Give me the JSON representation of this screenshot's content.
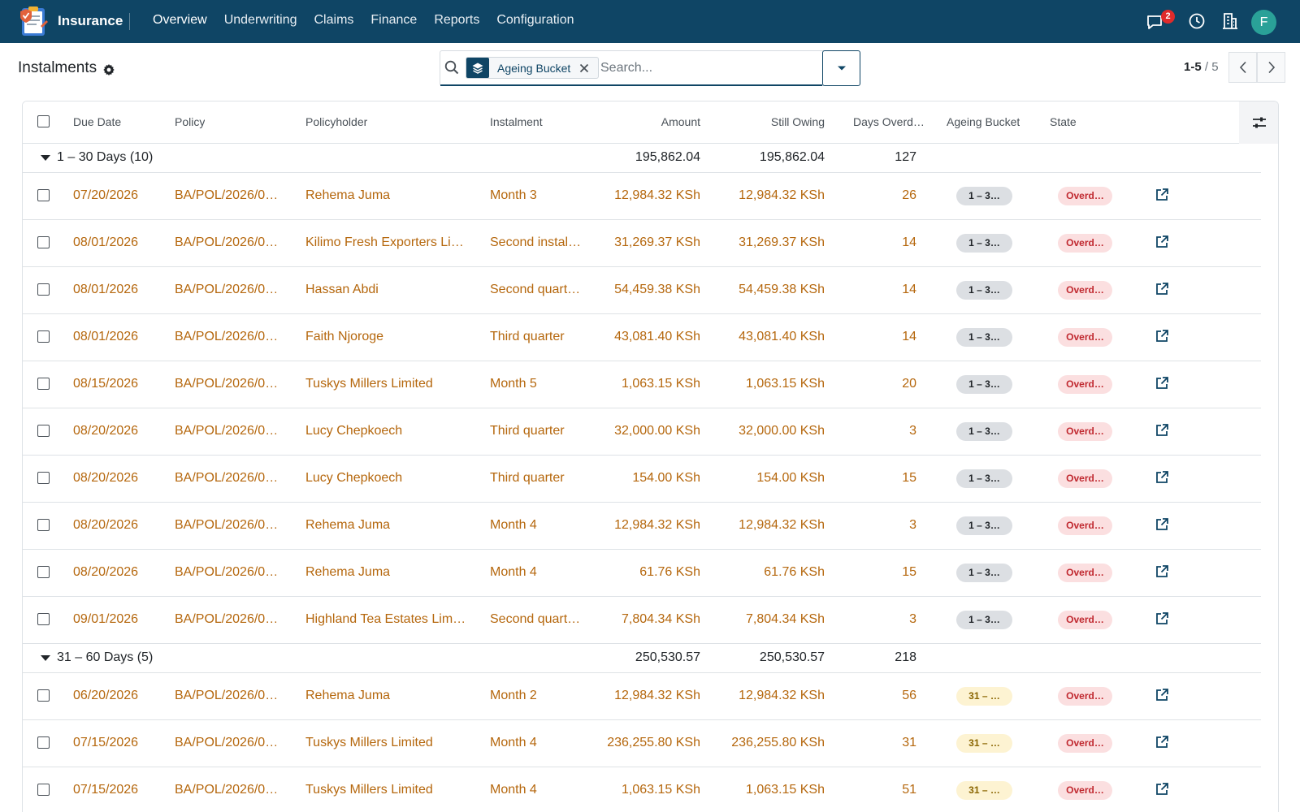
{
  "navbar": {
    "app_name": "Insurance",
    "menu": [
      "Overview",
      "Underwriting",
      "Claims",
      "Finance",
      "Reports",
      "Configuration"
    ],
    "notification_count": "2",
    "avatar_initial": "F",
    "icons": [
      "chat-icon",
      "clock-icon",
      "building-icon"
    ]
  },
  "control_panel": {
    "title": "Instalments",
    "facet_label": "Ageing Bucket",
    "search_placeholder": "Search...",
    "pager_range": "1-5",
    "pager_separator": " / ",
    "pager_total": "5"
  },
  "table": {
    "headers": [
      "Due Date",
      "Policy",
      "Policyholder",
      "Instalment",
      "Amount",
      "Still Owing",
      "Days Overd…",
      "Ageing Bucket",
      "State"
    ],
    "groups": [
      {
        "label": "1 – 30 Days (10)",
        "amount": "195,862.04",
        "still_owing": "195,862.04",
        "days": "127",
        "bucket_pill": "1 – 3…",
        "rows": [
          {
            "due": "07/20/2026",
            "policy": "BA/POL/2026/0…",
            "holder": "Rehema Juma",
            "instalment": "Month 3",
            "amount": "12,984.32 KSh",
            "owing": "12,984.32 KSh",
            "days": "26",
            "state": "Overd…"
          },
          {
            "due": "08/01/2026",
            "policy": "BA/POL/2026/0…",
            "holder": "Kilimo Fresh Exporters Li…",
            "instalment": "Second instal…",
            "amount": "31,269.37 KSh",
            "owing": "31,269.37 KSh",
            "days": "14",
            "state": "Overd…"
          },
          {
            "due": "08/01/2026",
            "policy": "BA/POL/2026/0…",
            "holder": "Hassan Abdi",
            "instalment": "Second quart…",
            "amount": "54,459.38 KSh",
            "owing": "54,459.38 KSh",
            "days": "14",
            "state": "Overd…"
          },
          {
            "due": "08/01/2026",
            "policy": "BA/POL/2026/0…",
            "holder": "Faith Njoroge",
            "instalment": "Third quarter",
            "amount": "43,081.40 KSh",
            "owing": "43,081.40 KSh",
            "days": "14",
            "state": "Overd…"
          },
          {
            "due": "08/15/2026",
            "policy": "BA/POL/2026/0…",
            "holder": "Tuskys Millers Limited",
            "instalment": "Month 5",
            "amount": "1,063.15 KSh",
            "owing": "1,063.15 KSh",
            "days": "20",
            "state": "Overd…"
          },
          {
            "due": "08/20/2026",
            "policy": "BA/POL/2026/0…",
            "holder": "Lucy Chepkoech",
            "instalment": "Third quarter",
            "amount": "32,000.00 KSh",
            "owing": "32,000.00 KSh",
            "days": "3",
            "state": "Overd…"
          },
          {
            "due": "08/20/2026",
            "policy": "BA/POL/2026/0…",
            "holder": "Lucy Chepkoech",
            "instalment": "Third quarter",
            "amount": "154.00 KSh",
            "owing": "154.00 KSh",
            "days": "15",
            "state": "Overd…"
          },
          {
            "due": "08/20/2026",
            "policy": "BA/POL/2026/0…",
            "holder": "Rehema Juma",
            "instalment": "Month 4",
            "amount": "12,984.32 KSh",
            "owing": "12,984.32 KSh",
            "days": "3",
            "state": "Overd…"
          },
          {
            "due": "08/20/2026",
            "policy": "BA/POL/2026/0…",
            "holder": "Rehema Juma",
            "instalment": "Month 4",
            "amount": "61.76 KSh",
            "owing": "61.76 KSh",
            "days": "15",
            "state": "Overd…"
          },
          {
            "due": "09/01/2026",
            "policy": "BA/POL/2026/0…",
            "holder": "Highland Tea Estates Lim…",
            "instalment": "Second quart…",
            "amount": "7,804.34 KSh",
            "owing": "7,804.34 KSh",
            "days": "3",
            "state": "Overd…"
          }
        ]
      },
      {
        "label": "31 – 60 Days (5)",
        "amount": "250,530.57",
        "still_owing": "250,530.57",
        "days": "218",
        "bucket_pill": "31 – …",
        "rows": [
          {
            "due": "06/20/2026",
            "policy": "BA/POL/2026/0…",
            "holder": "Rehema Juma",
            "instalment": "Month 2",
            "amount": "12,984.32 KSh",
            "owing": "12,984.32 KSh",
            "days": "56",
            "state": "Overd…"
          },
          {
            "due": "07/15/2026",
            "policy": "BA/POL/2026/0…",
            "holder": "Tuskys Millers Limited",
            "instalment": "Month 4",
            "amount": "236,255.80 KSh",
            "owing": "236,255.80 KSh",
            "days": "31",
            "state": "Overd…"
          },
          {
            "due": "07/15/2026",
            "policy": "BA/POL/2026/0…",
            "holder": "Tuskys Millers Limited",
            "instalment": "Month 4",
            "amount": "1,063.15 KSh",
            "owing": "1,063.15 KSh",
            "days": "51",
            "state": "Overd…"
          }
        ]
      }
    ]
  },
  "colors": {
    "navbar_bg": "#0f4565",
    "link_text": "#b5670d",
    "state_pill_bg": "#fbdfe0",
    "state_pill_text": "#c0282f",
    "bucket1_pill_bg": "#dcdfe3",
    "bucket2_pill_bg": "#fdf3d2"
  }
}
